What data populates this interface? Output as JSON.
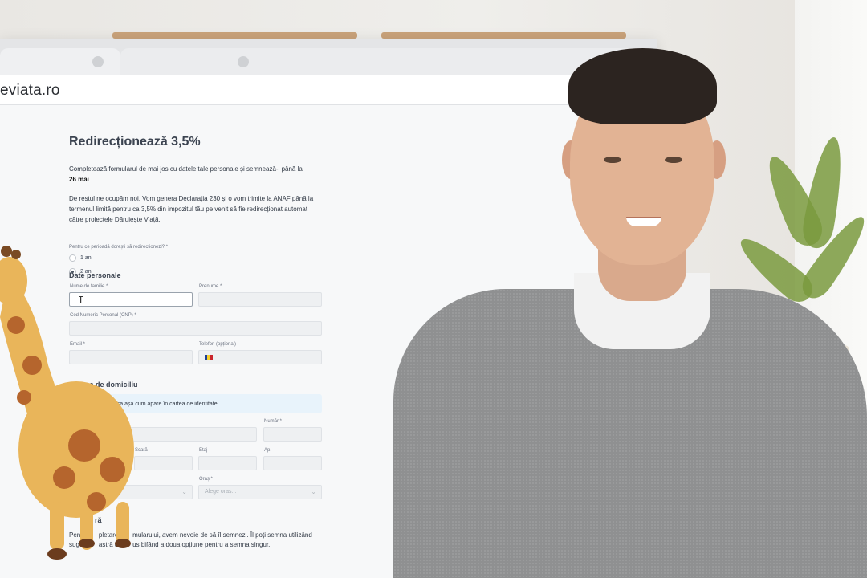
{
  "browser": {
    "url": "eviata.ro"
  },
  "form": {
    "title": "Redirecționează 3,5%",
    "intro_text": "Completează formularul de mai jos cu datele tale personale și semnează-l până la",
    "intro_date": "26 mai",
    "intro_dot": ".",
    "paragraph2": "De restul ne ocupăm noi. Vom genera Declarația 230 și o vom trimite la ANAF până la termenul limită pentru ca 3,5% din impozitul tău pe venit să fie redirecționat automat către proiectele Dăruiește Viață.",
    "period_question": "Pentru ce perioadă dorești să redirecționezi? *",
    "period_options": [
      {
        "label": "1 an",
        "selected": false
      },
      {
        "label": "2 ani",
        "selected": true
      }
    ],
    "personal_section": "Date personale",
    "fields": {
      "last_name": "Nume de familie *",
      "first_name": "Prenume *",
      "cnp": "Cod Numeric Personal (CNP) *",
      "email": "Email *",
      "phone": "Telefon (opțional)"
    },
    "address_section": "Adresa de domiciliu",
    "address_info": "Introdu adresa așa cum apare în cartea de identitate",
    "address_fields": {
      "number": "Număr *",
      "staircase": "Scară",
      "floor": "Etaj",
      "apartment": "Ap.",
      "city": "Oraș *",
      "city_placeholder": "Alege oraș..."
    },
    "signature_section_partial": "ră",
    "signature_text_line1": "Pentru      pletarea      mularului, avem nevoie de să îl semnezi. Îl poți semna utilizând",
    "signature_text_line2": "sugest      astră de      us bifând a doua opțiune pentru a semna singur."
  },
  "icons": {
    "info": "info-icon",
    "flag": "romania-flag-icon",
    "chevron": "chevron-down-icon",
    "cursor": "text-cursor-icon"
  },
  "colors": {
    "info_box_bg": "#e8f3fb",
    "info_icon": "#2563eb",
    "field_bg": "#eef0f2"
  }
}
